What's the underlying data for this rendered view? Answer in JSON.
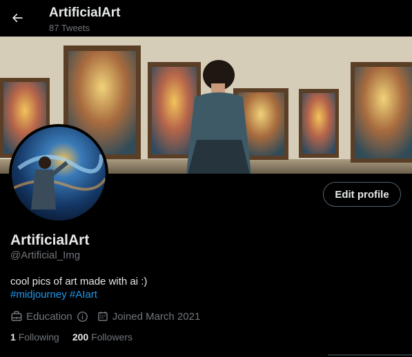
{
  "header": {
    "back_icon": "arrow-left-icon",
    "title": "ArtificialArt",
    "tweet_count": "87 Tweets"
  },
  "profile": {
    "display_name": "ArtificialArt",
    "handle": "@Artificial_Img",
    "bio": "cool pics of art made with ai :)",
    "hashtags": [
      "#midjourney",
      "#AIart"
    ],
    "edit_button": "Edit profile",
    "category": "Education",
    "category_icon": "briefcase-icon",
    "joined": "Joined March 2021",
    "joined_icon": "calendar-icon",
    "following_count": "1",
    "following_label": "Following",
    "followers_count": "200",
    "followers_label": "Followers"
  },
  "colors": {
    "background": "#000000",
    "text_primary": "#e7e9ea",
    "text_secondary": "#71767b",
    "link": "#1d9bf0",
    "button_border": "#536471"
  }
}
